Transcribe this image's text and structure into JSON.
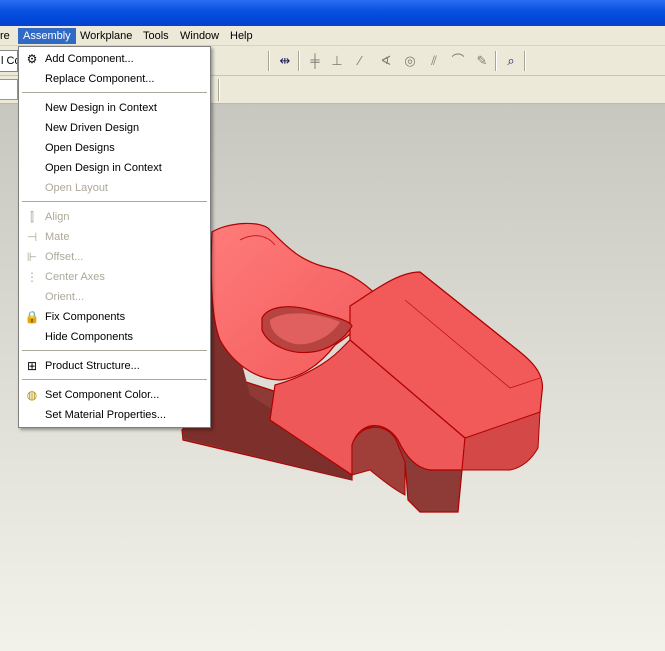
{
  "menubar": {
    "items": [
      "re",
      "Assembly",
      "Workplane",
      "Tools",
      "Window",
      "Help"
    ]
  },
  "toolbar": {
    "left_field_text": "l Co"
  },
  "assembly_menu": {
    "add_component": "Add Component...",
    "replace_component": "Replace Component...",
    "new_design_in_context": "New Design in Context",
    "new_driven_design": "New Driven Design",
    "open_designs": "Open Designs",
    "open_design_in_context": "Open Design in Context",
    "open_layout": "Open Layout",
    "align": "Align",
    "mate": "Mate",
    "offset": "Offset...",
    "center_axes": "Center Axes",
    "orient": "Orient...",
    "fix_components": "Fix Components",
    "hide_components": "Hide Components",
    "product_structure": "Product Structure...",
    "set_component_color": "Set Component Color...",
    "set_material_properties": "Set Material Properties..."
  },
  "colors": {
    "title_bar": "#0a52e0",
    "menu_highlight": "#316ac5",
    "part_fill": "#f25a5a",
    "part_edge": "#b00000"
  },
  "icons": {
    "add_component": "add-component-icon",
    "align": "align-icon",
    "mate": "mate-icon",
    "offset": "offset-icon",
    "center_axes": "center-axes-icon",
    "fix_components": "lock-key-icon",
    "product_structure": "tree-structure-icon",
    "set_component_color": "color-palette-icon"
  }
}
